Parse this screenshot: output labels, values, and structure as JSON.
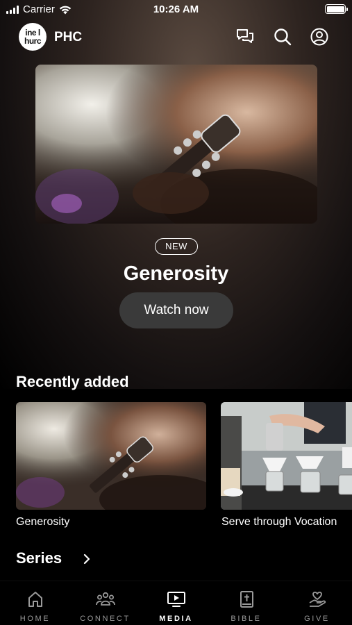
{
  "status_bar": {
    "carrier": "Carrier",
    "time": "10:26 AM"
  },
  "header": {
    "logo_line1": "ine l",
    "logo_line2": "hurc",
    "brand": "PHC"
  },
  "hero": {
    "badge": "NEW",
    "title": "Generosity",
    "button": "Watch now"
  },
  "recently_added": {
    "title": "Recently added",
    "items": [
      {
        "label": "Generosity"
      },
      {
        "label": "Serve through Vocation"
      }
    ]
  },
  "series": {
    "title": "Series"
  },
  "tabbar": {
    "items": [
      {
        "label": "HOME",
        "icon": "home-icon"
      },
      {
        "label": "CONNECT",
        "icon": "people-icon"
      },
      {
        "label": "MEDIA",
        "icon": "tv-play-icon",
        "active": true
      },
      {
        "label": "BIBLE",
        "icon": "bible-icon"
      },
      {
        "label": "GIVE",
        "icon": "give-heart-icon"
      }
    ]
  },
  "colors": {
    "background": "#000000",
    "button_bg": "#3a3a3a",
    "inactive_tab": "#9a9a9a"
  }
}
